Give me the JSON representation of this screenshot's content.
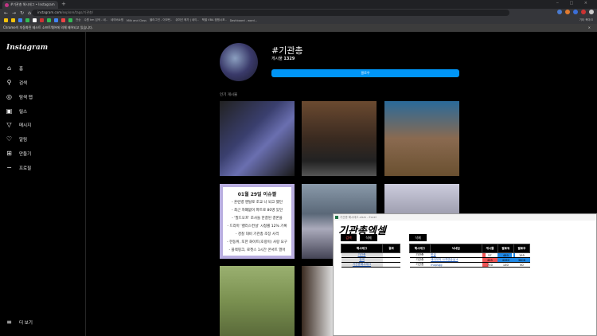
{
  "browser": {
    "tab_title": "#기관총 해시태그 • Instagram",
    "new_tab": "+",
    "url_host": "instagram.com",
    "url_path": "/explore/tags/기관총/",
    "bookmarks": [
      "전승",
      "수원 km 검색 - 네..",
      "네이버쇼핑",
      "Milk and Class",
      "블라그인 - 이모틴..",
      "쉬미선 메가 | 네이..",
      "책별 VBA 캠핑시포..",
      "Dashboard - word...",
      "기타 북마크"
    ],
    "infobar": "Chrome이 자동화된 테스트 소프트웨어에 의해 제어되고 있습니다.",
    "infobar_close": "×"
  },
  "sidebar": {
    "logo": "Instagram",
    "items": [
      {
        "icon": "home-icon",
        "glyph": "⌂",
        "label": "홈"
      },
      {
        "icon": "search-icon",
        "glyph": "⚲",
        "label": "검색"
      },
      {
        "icon": "compass-icon",
        "glyph": "◎",
        "label": "탐색 탭"
      },
      {
        "icon": "reels-icon",
        "glyph": "▣",
        "label": "릴스"
      },
      {
        "icon": "send-icon",
        "glyph": "▽",
        "label": "메시지"
      },
      {
        "icon": "heart-icon",
        "glyph": "♡",
        "label": "알림"
      },
      {
        "icon": "plus-square-icon",
        "glyph": "⊞",
        "label": "만들기"
      },
      {
        "icon": "profile-icon",
        "glyph": "−",
        "label": "프로필"
      }
    ],
    "more": {
      "icon": "menu-icon",
      "glyph": "≡",
      "label": "더 보기"
    }
  },
  "hashtag": {
    "title": "#기관총",
    "posts_label": "게시물",
    "posts_count": "1329",
    "follow": "팔로우",
    "popular": "인기 게시물"
  },
  "note_post": {
    "heading": "01월 29일 이슈짤",
    "lines": [
      "- 훈련병 멘탈로 조교 나 되고 했던",
      "- 최근 자폐없이 파트로 80명 있던",
      "- '필드오프' 조사들 한결된 결론을",
      "- 드라마 '캘러스컨설' 시청률 12% 기록",
      "- 경찰 대비 기관총 조장 사격",
      "- 한동위, 또한 화이트(호랑이) 사랑 요구",
      "- 블랙핑크, 로젯스 1시간 콘서트 열어"
    ]
  },
  "excel": {
    "window_title": "기관총 해시태그.xlsm - Excel",
    "heading": "기관총엑셀",
    "search_btn": "검색",
    "delete_btn": "삭제",
    "delete_btn2": "삭제",
    "left_headers": [
      "해시태그",
      "결과"
    ],
    "left_rows": [
      [
        "기관총",
        ""
      ],
      [
        "검색",
        ""
      ],
      [
        "기관총해시태그",
        ""
      ]
    ],
    "right_headers": [
      "해시태그",
      "닉네임",
      "게시물",
      "팔로워",
      "팔로우"
    ],
    "right_rows": [
      {
        "tag": "기관총",
        "nick": "한글",
        "posts": "57",
        "followers": "469",
        "following": "195",
        "posts_pct": 20,
        "followers_pct": 90,
        "following_pct": 10
      },
      {
        "tag": "기관총",
        "nick": "에이잇의 사격연습실 4",
        "posts": "465",
        "followers": "4260",
        "following": "3606",
        "posts_pct": 100,
        "followers_pct": 100,
        "following_pct": 100
      },
      {
        "tag": "기관총",
        "nick": "mopsgg",
        "posts": "750",
        "followers": "130",
        "following": "50",
        "posts_pct": 40,
        "followers_pct": 0,
        "following_pct": 0
      }
    ]
  }
}
